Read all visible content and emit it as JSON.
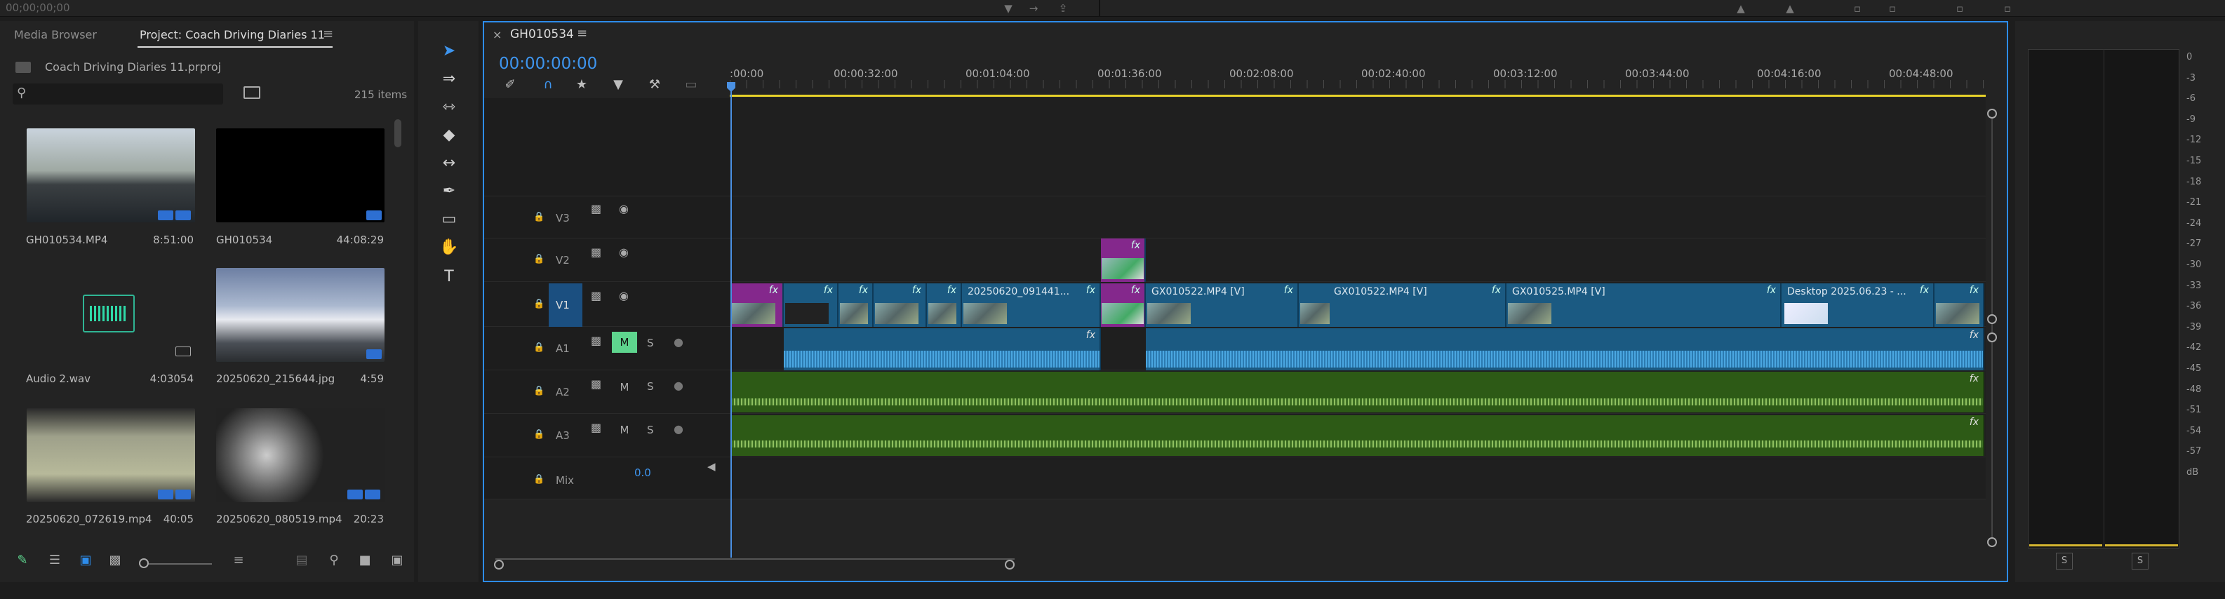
{
  "top_bar": {
    "timecode": "00;00;00;00"
  },
  "project_panel": {
    "tab_media_browser": "Media Browser",
    "tab_project": "Project: Coach Driving Diaries 11",
    "project_file": "Coach Driving Diaries 11.prproj",
    "search": {
      "value": "",
      "placeholder": ""
    },
    "items_count": "215 items",
    "items": [
      {
        "name": "GH010534.MP4",
        "duration": "8:51:00"
      },
      {
        "name": "GH010534",
        "duration": "44:08:29"
      },
      {
        "name": "Audio 2.wav",
        "duration": "4:03054"
      },
      {
        "name": "20250620_215644.jpg",
        "duration": "4:59"
      },
      {
        "name": "20250620_072619.mp4",
        "duration": "40:05"
      },
      {
        "name": "20250620_080519.mp4",
        "duration": "20:23"
      }
    ]
  },
  "sequence": {
    "name": "GH010534",
    "timecode": "00:00:00:00",
    "ruler": [
      ":00:00",
      "00:00:32:00",
      "00:01:04:00",
      "00:01:36:00",
      "00:02:08:00",
      "00:02:40:00",
      "00:03:12:00",
      "00:03:44:00",
      "00:04:16:00",
      "00:04:48:00"
    ],
    "tracks": {
      "v3": "V3",
      "v2": "V2",
      "v1": "V1",
      "a1": "A1",
      "a2": "A2",
      "a3": "A3",
      "mix": "Mix"
    },
    "mute_label": "M",
    "solo_label": "S",
    "mix_value": "0.0",
    "clip_labels": {
      "c1": "20250620_091441...",
      "c2": "GX010522.MP4 [V]",
      "c3": "GX010522.MP4 [V]",
      "c4": "GX010525.MP4 [V]",
      "c5": "Desktop 2025.06.23 - ..."
    },
    "fx_label": "fx"
  },
  "meters": {
    "db_scale": [
      "0",
      "-3",
      "-6",
      "-9",
      "-12",
      "-15",
      "-18",
      "-21",
      "-24",
      "-27",
      "-30",
      "-33",
      "-36",
      "-39",
      "-42",
      "-45",
      "-48",
      "-51",
      "-54",
      "-57",
      "dB"
    ],
    "solo_left": "S",
    "solo_right": "S"
  }
}
